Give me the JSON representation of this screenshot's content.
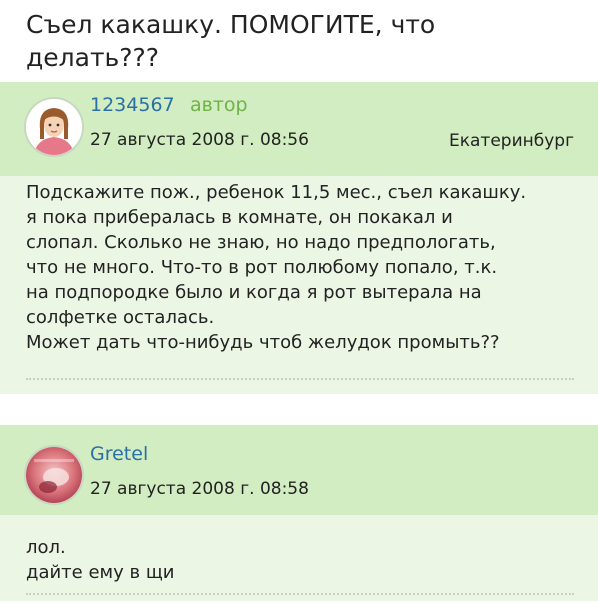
{
  "topic": {
    "title_line1": "Съел какашку. ПОМОГИТЕ, что",
    "title_line2": "делать???"
  },
  "posts": [
    {
      "username": "1234567",
      "author_tag": "автор",
      "date": "27 августа 2008 г. 08:56",
      "city": "Екатеринбург",
      "avatar_icon": "woman-avatar-icon",
      "lines": [
        "Подскажите пож., ребенок 11,5 мес., съел какашку.",
        "я пока прибералась в комнате, он покакал и",
        "слопал. Сколько не знаю, но надо предпологать,",
        "что не много. Что-то в рот полюбому попало, т.к.",
        "на подпородке было и когда я рот вытерала на",
        "солфетке осталась.",
        "Может дать что-нибудь чтоб желудок промыть??"
      ]
    },
    {
      "username": "Gretel",
      "date": "27 августа 2008 г. 08:58",
      "avatar_icon": "photo-avatar-icon",
      "lines": [
        "лол.",
        "дайте ему в щи"
      ]
    }
  ],
  "colors": {
    "header_bg": "#d2edc1",
    "body_bg": "#ecf6e5",
    "username": "#2a6fa6",
    "author_tag": "#6fb247"
  }
}
